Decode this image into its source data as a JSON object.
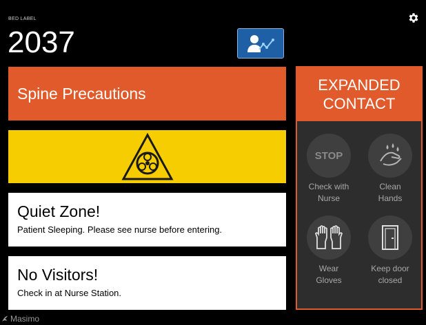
{
  "header": {
    "bed_label_caption": "BED LABEL",
    "bed_number": "2037",
    "trend_button_icon": "patient-trend-icon",
    "settings_icon": "gear-icon"
  },
  "alerts": {
    "spine": "Spine Precautions",
    "hazard_icon": "biohazard-icon",
    "quiet_title": "Quiet Zone!",
    "quiet_sub": "Patient Sleeping. Please see nurse before entering.",
    "visitors_title": "No Visitors!",
    "visitors_sub": "Check in at Nurse Station."
  },
  "expanded_contact": {
    "title_line1": "EXPANDED",
    "title_line2": "CONTACT",
    "items": [
      {
        "icon": "stop-sign-icon",
        "icon_text": "STOP",
        "line1": "Check with",
        "line2": "Nurse"
      },
      {
        "icon": "clean-hands-icon",
        "line1": "Clean",
        "line2": "Hands"
      },
      {
        "icon": "gloves-icon",
        "line1": "Wear",
        "line2": "Gloves"
      },
      {
        "icon": "door-icon",
        "line1": "Keep door",
        "line2": "closed"
      }
    ]
  },
  "footer": {
    "brand": "Masimo"
  },
  "colors": {
    "accent_orange": "#e05a2b",
    "hazard_yellow": "#f5cd00",
    "trend_blue": "#1f5fa6",
    "panel_dark": "#2d2d2d"
  }
}
